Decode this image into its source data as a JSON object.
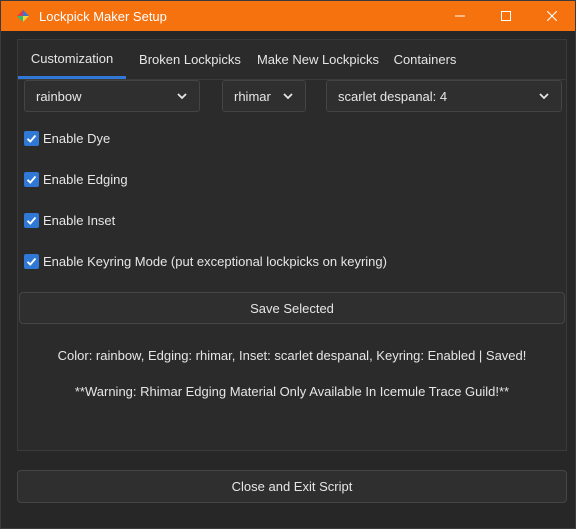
{
  "window": {
    "title": "Lockpick Maker Setup",
    "icon": "app-logo-icon",
    "controls": [
      "minimize-icon",
      "maximize-icon",
      "close-icon"
    ],
    "titlebar_color": "#f5720f"
  },
  "tabs": [
    {
      "label": "Customization",
      "active": true
    },
    {
      "label": "Broken Lockpicks",
      "active": false
    },
    {
      "label": "Make New Lockpicks",
      "active": false
    },
    {
      "label": "Containers",
      "active": false
    }
  ],
  "dropdowns": {
    "color": "rainbow",
    "edging": "rhimar",
    "inset": "scarlet despanal: 4"
  },
  "checkboxes": [
    {
      "label": "Enable Dye",
      "checked": true
    },
    {
      "label": "Enable Edging",
      "checked": true
    },
    {
      "label": "Enable Inset",
      "checked": true
    },
    {
      "label": "Enable Keyring Mode (put exceptional lockpicks on keyring)",
      "checked": true
    }
  ],
  "save_button": "Save Selected",
  "status": {
    "summary": "Color: rainbow, Edging: rhimar, Inset: scarlet despanal, Keyring: Enabled | Saved!",
    "warning": "**Warning: Rhimar Edging Material Only Available In Icemule Trace Guild!**"
  },
  "close_button": "Close and Exit Script",
  "accent_color": "#2f78d6"
}
